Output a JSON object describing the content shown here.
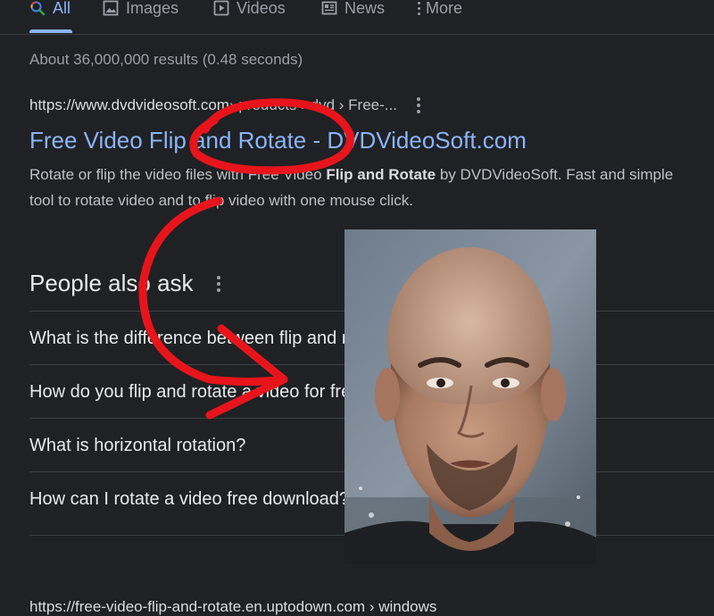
{
  "tabs": [
    {
      "label": "All",
      "icon": "search-icon",
      "active": true
    },
    {
      "label": "Images",
      "icon": "image-icon"
    },
    {
      "label": "Videos",
      "icon": "play-icon"
    },
    {
      "label": "News",
      "icon": "news-icon"
    },
    {
      "label": "More",
      "icon": "more-vert-icon"
    }
  ],
  "result_stats": "About 36,000,000 results (0.48 seconds)",
  "result1": {
    "url_domain": "https://www.dvdvideosoft.com",
    "url_path": " › products › dvd › Free-...",
    "title": "Free Video Flip and Rotate - DVDVideoSoft.com",
    "snippet_line1_pre": "Rotate or flip the video files with Free Video ",
    "snippet_line1_bold": "Flip and Rotate",
    "snippet_line1_post": " by DVDVideoSoft. Fast and simple",
    "snippet_line2": "tool to rotate video and to flip video with one mouse click."
  },
  "people_also_ask": {
    "heading": "People also ask",
    "questions": [
      "What is the difference between flip and rotate?",
      "How do you flip and rotate a video for free?",
      "What is horizontal rotation?",
      "How can I rotate a video free download?"
    ]
  },
  "next_result_url": "https://free-video-flip-and-rotate.en.uptodown.com › windows",
  "colors": {
    "background": "#202124",
    "link": "#8ab4f8",
    "annotation_red": "#e8141b"
  }
}
